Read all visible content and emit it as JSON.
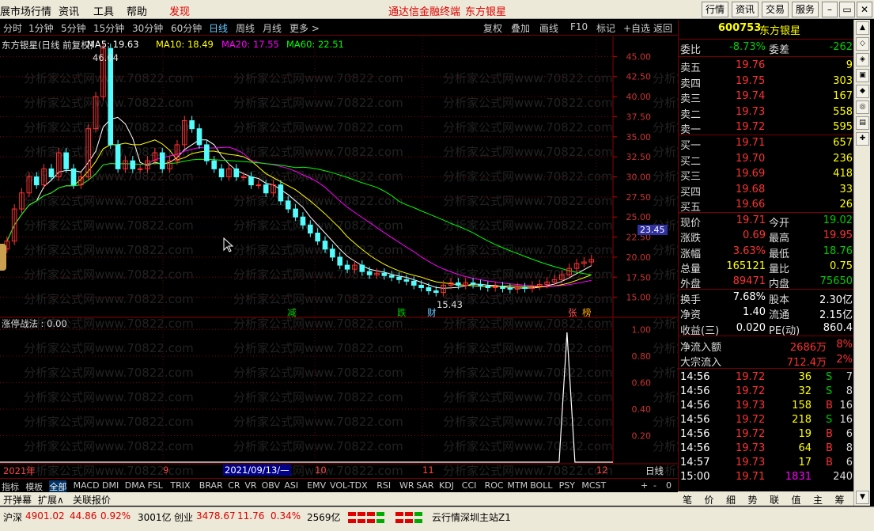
{
  "menubar": {
    "items": [
      "展市场行情",
      "资讯",
      "工具",
      "帮助",
      "发现"
    ],
    "center_title": "通达信金融终端",
    "center_stock": "东方银星",
    "right_buttons": [
      "行情",
      "资讯",
      "交易",
      "服务"
    ]
  },
  "periods": [
    "分时",
    "1分钟",
    "5分钟",
    "15分钟",
    "30分钟",
    "60分钟",
    "日线",
    "周线",
    "月线",
    "更多 >"
  ],
  "period_selected": "日线",
  "tools": [
    "复权",
    "叠加",
    "画线",
    "F10",
    "标记",
    "+自选",
    "返回"
  ],
  "chart_info": {
    "name": "东方银星(日线 前复权)",
    "ma5": "MA5: 19.63",
    "ma10": "MA10: 18.49",
    "ma20": "MA20: 17.55",
    "ma60": "MA60: 22.51",
    "high_label": "46.04",
    "low_label": "15.43",
    "price_box": "23.45",
    "y_ticks": [
      "45.00",
      "42.50",
      "40.00",
      "37.50",
      "35.00",
      "32.50",
      "30.00",
      "27.50",
      "25.00",
      "22.50",
      "20.00",
      "17.50",
      "15.00"
    ],
    "markers": [
      "减",
      "跌",
      "财",
      "张",
      "榜"
    ],
    "watermark": "分析家公式网www.70822.com"
  },
  "indicator": {
    "title": "涨停战法 : 0.00",
    "y_ticks": [
      "1.00",
      "0.80",
      "0.60",
      "0.40",
      "0.20"
    ]
  },
  "x_axis": {
    "labels": [
      "2021年",
      "9",
      "2021/09/13/—",
      "10",
      "11",
      "12"
    ],
    "period": "日线"
  },
  "tabs": [
    "指标",
    "模板",
    "全部",
    "MACD",
    "DMI",
    "DMA",
    "FSL",
    "TRIX",
    "BRAR",
    "CR",
    "VR",
    "OBV",
    "ASI",
    "EMV",
    "VOL-TDX",
    "RSI",
    "WR",
    "SAR",
    "KDJ",
    "CCI",
    "ROC",
    "MTM",
    "BOLL",
    "PSY",
    "MCST"
  ],
  "tab_selected": "全部",
  "tab_controls": [
    "+",
    "-",
    "0"
  ],
  "tabs2": [
    "开弹幕",
    "扩展∧",
    "关联报价"
  ],
  "quote": {
    "code": "600753",
    "name": "东方银星",
    "weibi_label": "委比",
    "weibi": "-8.73%",
    "weicha_label": "委差",
    "weicha": "-262",
    "asks": [
      {
        "l": "卖五",
        "p": "19.76",
        "v": "9"
      },
      {
        "l": "卖四",
        "p": "19.75",
        "v": "303"
      },
      {
        "l": "卖三",
        "p": "19.74",
        "v": "167"
      },
      {
        "l": "卖二",
        "p": "19.73",
        "v": "558"
      },
      {
        "l": "卖一",
        "p": "19.72",
        "v": "595"
      }
    ],
    "bids": [
      {
        "l": "买一",
        "p": "19.71",
        "v": "657"
      },
      {
        "l": "买二",
        "p": "19.70",
        "v": "236"
      },
      {
        "l": "买三",
        "p": "19.69",
        "v": "418"
      },
      {
        "l": "买四",
        "p": "19.68",
        "v": "33"
      },
      {
        "l": "买五",
        "p": "19.66",
        "v": "26"
      }
    ],
    "stats": [
      {
        "l1": "现价",
        "v1": "19.71",
        "c1": "up",
        "l2": "今开",
        "v2": "19.02",
        "c2": "dn"
      },
      {
        "l1": "涨跌",
        "v1": "0.69",
        "c1": "up",
        "l2": "最高",
        "v2": "19.95",
        "c2": "up"
      },
      {
        "l1": "涨幅",
        "v1": "3.63%",
        "c1": "up",
        "l2": "最低",
        "v2": "18.76",
        "c2": "dn"
      },
      {
        "l1": "总量",
        "v1": "165121",
        "c1": "yel",
        "l2": "量比",
        "v2": "0.75",
        "c2": "yel"
      },
      {
        "l1": "外盘",
        "v1": "89471",
        "c1": "up",
        "l2": "内盘",
        "v2": "75650",
        "c2": "dn"
      }
    ],
    "stats2": [
      {
        "l1": "换手",
        "v1": "7.68%",
        "l2": "股本",
        "v2": "2.30亿"
      },
      {
        "l1": "净资",
        "v1": "1.40",
        "l2": "流通",
        "v2": "2.15亿"
      },
      {
        "l1": "收益(三)",
        "v1": "0.020",
        "l2": "PE(动)",
        "v2": "860.4"
      }
    ],
    "flow": [
      {
        "l": "净流入额",
        "v": "2686万",
        "p": "8%"
      },
      {
        "l": "大宗流入",
        "v": "712.4万",
        "p": "2%"
      }
    ],
    "ticks": [
      {
        "t": "14:56",
        "p": "19.72",
        "v": "36",
        "s": "S",
        "n": "7"
      },
      {
        "t": "14:56",
        "p": "19.72",
        "v": "32",
        "s": "S",
        "n": "8"
      },
      {
        "t": "14:56",
        "p": "19.73",
        "v": "158",
        "s": "B",
        "n": "16"
      },
      {
        "t": "14:56",
        "p": "19.72",
        "v": "218",
        "s": "S",
        "n": "16"
      },
      {
        "t": "14:56",
        "p": "19.72",
        "v": "19",
        "s": "B",
        "n": "6"
      },
      {
        "t": "14:56",
        "p": "19.73",
        "v": "64",
        "s": "B",
        "n": "8"
      },
      {
        "t": "14:57",
        "p": "19.73",
        "v": "17",
        "s": "B",
        "n": "6"
      },
      {
        "t": "15:00",
        "p": "19.71",
        "v": "1831",
        "s": "",
        "n": "240"
      }
    ],
    "tabs": [
      "笔",
      "价",
      "细",
      "势",
      "联",
      "值",
      "主",
      "筹"
    ]
  },
  "status": {
    "sh_label": "沪深",
    "sh_val": "4901.02",
    "sh_chg": "44.86",
    "sh_pct": "0.92%",
    "sh_amt": "3001亿",
    "cy_label": "创业",
    "cy_val": "3478.67",
    "cy_chg": "11.76",
    "cy_pct": "0.34%",
    "cy_amt": "2569亿",
    "server": "云行情深圳主站Z1"
  }
}
